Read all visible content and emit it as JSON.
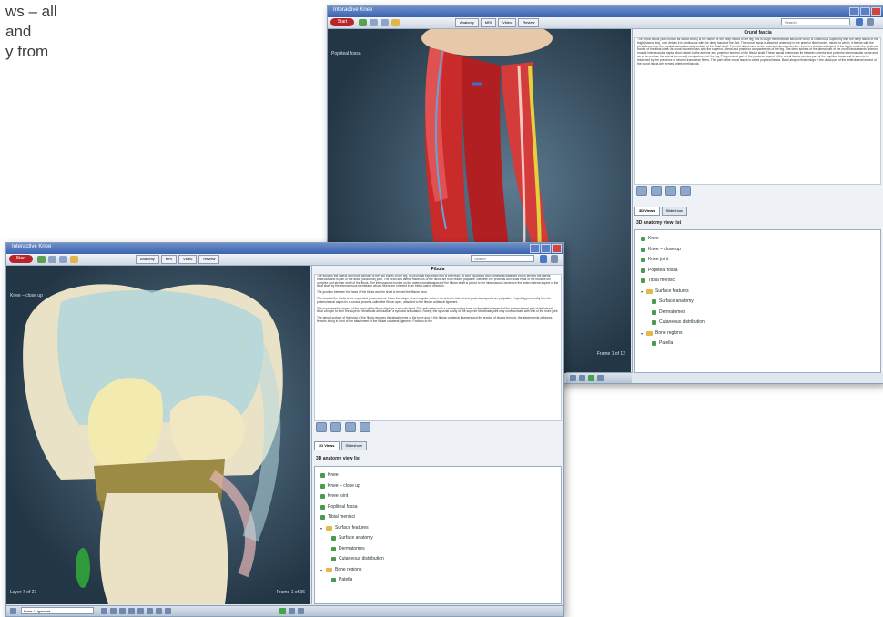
{
  "caption_fragment": [
    "ws – all",
    "and",
    "y from"
  ],
  "back_window": {
    "title": "Interactive Knee",
    "start_label": "Start",
    "tabs": [
      "Anatomy",
      "MRI",
      "Video",
      "Review"
    ],
    "search_placeholder": "Search",
    "viewport_label": "Popliteal fossa",
    "frame_label": "Frame 1 of 12",
    "panel_title": "Crural fascia",
    "panel_text": [
      "The crural fascia (also known as fascia cruris) is the name for the deep fascia of the leg; this is tough membranous structure which is continuous superiorly with the deep fascia of the thigh (fascia lata), onto details it is continuous with the deep fascia of the foot. The crural fascia is attached anteriorly to the anterior tibial border, medial to which, it blends with the periosteum over the medial (subcutaneous) surface of the tibial shaft. From its attachment to the anterior interosseous line, it covers the lateral aspect of the leg to reach the posterior border of the tibial shaft; its crural is continuous with the superior, lateral and posterior compartments of the leg. The deep surface of the lateral part of the crural fascia sends anterior, muscle intermuscular septa which attach to the anterior and posterior borders of the fibular shaft. These fascial extensions lie between anterior and posterior intermuscular septa and serve to enclose the lateral (peroneal) compartment of the leg. The proximal part of the posterior aspect of the crural fascia overlies part of the popliteal fossa and is seen to be thickened by the presence of several transverse fibers. This part of the crural fascia is called popliteal fascia. Band-shaped thickenings in the distal part of the anterolateral aspect of the crural fascia are termed anterior retinacula."
    ],
    "subtabs": [
      "3D Views",
      "Slideshow"
    ],
    "list_header": "3D anatomy view list",
    "tree": [
      {
        "label": "Knee",
        "kind": "item",
        "indent": 0
      },
      {
        "label": "Knee – close up",
        "kind": "item",
        "indent": 0
      },
      {
        "label": "Knee joint",
        "kind": "item",
        "indent": 0
      },
      {
        "label": "Popliteal fossa",
        "kind": "item",
        "indent": 0
      },
      {
        "label": "Tibial menisci",
        "kind": "item",
        "indent": 0
      },
      {
        "label": "Surface features",
        "kind": "folder",
        "indent": 0
      },
      {
        "label": "Surface anatomy",
        "kind": "item",
        "indent": 1
      },
      {
        "label": "Dermatomes",
        "kind": "item",
        "indent": 1
      },
      {
        "label": "Cutaneous distribution",
        "kind": "item",
        "indent": 1
      },
      {
        "label": "Bone regions",
        "kind": "folder",
        "indent": 0
      },
      {
        "label": "Patella",
        "kind": "item",
        "indent": 1
      }
    ]
  },
  "front_window": {
    "title": "Interactive Knee",
    "start_label": "Start",
    "tabs": [
      "Anatomy",
      "MRI",
      "Video",
      "Review"
    ],
    "search_placeholder": "Search",
    "viewport_label": "Knee – close up",
    "layer_label": "Layer 7 of 27",
    "frame_label": "Frame 1 of 36",
    "panel_title": "Fibula",
    "panel_text": [
      "The fibula is the lateral and more slender of the two bones of the leg. Its proximal expanded end is the head; its slim expanded and somewhat flattened end is termed the lateral malleolus and is part of the ankle (talocrural) joint. The head and lateral malleolus of the fibula are both readily palpable. Between the proximal and distal ends of the fibula is the complex and slender shaft of the fibula. The interosseous border on the antero-medial aspect of the fibular shaft is joined to the interosseous border on the antero-lateral aspect of the tibial shaft by the interosseous membrane whose fibers are oriented in an infero-lateral direction.",
      "The junction between the head of the fibula and the shaft is termed the fibular neck.",
      "The head of the fibula is the expanded proximal end. It has the shape of an irregular sphere. Its anterior, lateral and posterior aspects are palpable. Projecting proximally from its posterolateral aspect is a conical process called the fibular apex, attached to the fibular collateral ligament.",
      "The superomedial aspect of the head of the fibula displays a smooth facet. This articulates with a corresponding facet on the inferior aspect of the posterolateral part of the lateral tibial condyle to form the superior tibiofibular articulation, a synovial articulation. Rarely, the synovial cavity of the superior tibiofibular joint may communicate with that of the knee joint.",
      "The lateral surface of the head of the fibula receives the attachments of the knee and in the fibular collateral ligament and the tendon of biceps femoris; the attachments of biceps femoris being in front of the attachment of the fibular collateral ligament. Portions to the"
    ],
    "subtabs": [
      "3D Views",
      "Slideshow"
    ],
    "list_header": "3D anatomy view list",
    "tree": [
      {
        "label": "Knee",
        "kind": "item",
        "indent": 0
      },
      {
        "label": "Knee – close up",
        "kind": "item",
        "indent": 0
      },
      {
        "label": "Knee joint",
        "kind": "item",
        "indent": 0
      },
      {
        "label": "Popliteal fossa",
        "kind": "item",
        "indent": 0
      },
      {
        "label": "Tibial menisci",
        "kind": "item",
        "indent": 0
      },
      {
        "label": "Surface features",
        "kind": "folder",
        "indent": 0
      },
      {
        "label": "Surface anatomy",
        "kind": "item",
        "indent": 1
      },
      {
        "label": "Dermatomes",
        "kind": "item",
        "indent": 1
      },
      {
        "label": "Cutaneous distribution",
        "kind": "item",
        "indent": 1
      },
      {
        "label": "Bone regions",
        "kind": "folder",
        "indent": 0
      },
      {
        "label": "Patella",
        "kind": "item",
        "indent": 1
      }
    ],
    "status_layer_select": "Bone / Ligament"
  }
}
